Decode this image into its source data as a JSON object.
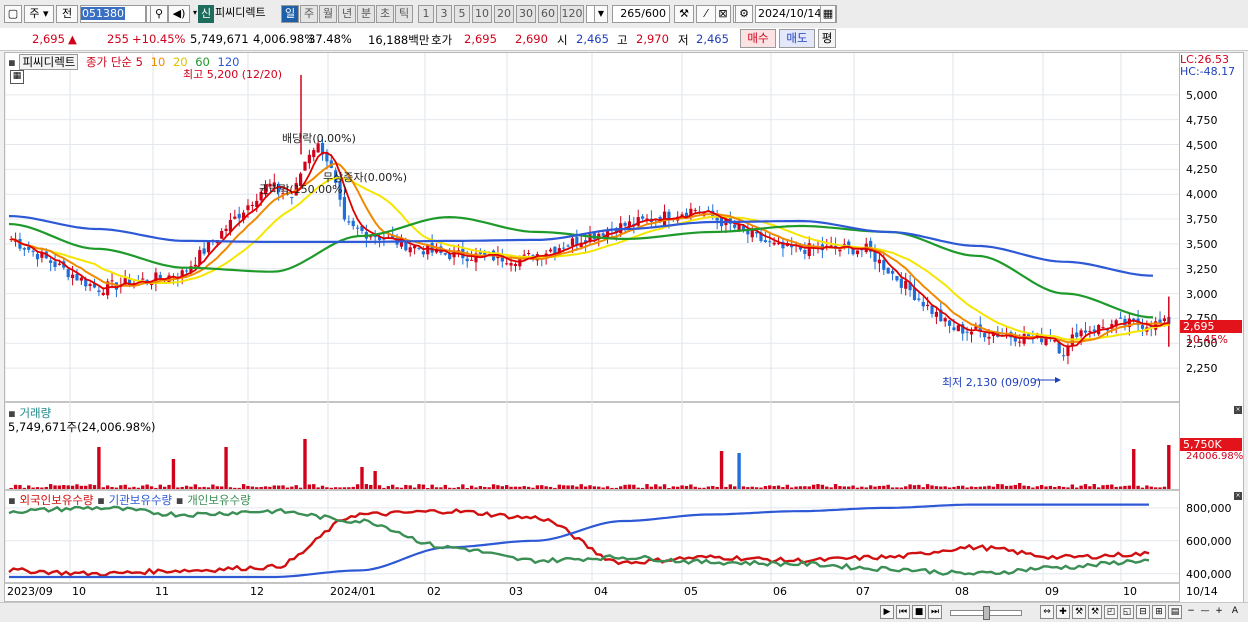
{
  "toolbar": {
    "market_type": "주",
    "market_all": "전",
    "stock_code": "051380",
    "stock_badge": "신",
    "stock_name": "피씨디렉트",
    "periods": [
      "일",
      "주",
      "월",
      "년",
      "분",
      "초",
      "틱"
    ],
    "minute_options": [
      "1",
      "3",
      "5",
      "10",
      "20",
      "30",
      "60",
      "120"
    ],
    "count_value": "265",
    "count_total": "/600",
    "date": "2024/10/14"
  },
  "quote": {
    "price": "2,695",
    "arrow": "▲",
    "change": "255",
    "change_pct": "+10.45%",
    "volume": "5,749,671",
    "volume_pct": "4,006.98%",
    "turnover": "37.48%",
    "amount": "16,188백만",
    "ask_label": "호가",
    "ask": "2,695",
    "bid": "2,690",
    "open_label": "시",
    "open": "2,465",
    "high_label": "고",
    "high": "2,970",
    "low_label": "저",
    "low": "2,465",
    "buy": "매수",
    "sell": "매도",
    "eval": "평"
  },
  "legend": {
    "name": "피씨디렉트",
    "ma_label": "종가 단순",
    "ma": [
      "5",
      "10",
      "20",
      "60",
      "120"
    ],
    "volume_title": "거래량",
    "volume_value": "5,749,671주(24,006.98%)",
    "holdings": [
      "외국인보유수량",
      "기관보유수량",
      "개인보유수량"
    ]
  },
  "annotations": {
    "high": "최고 5,200 (12/20)",
    "low": "최저 2,130 (09/09)",
    "dividend": "배당락(0.00%)",
    "rights": "권리락(150.00%)",
    "bonus": "무상증자(0.00%)"
  },
  "axis": {
    "lc": "LC:26.53",
    "hc": "HC:-48.17",
    "price_ticks": [
      "5,000",
      "4,750",
      "4,500",
      "4,250",
      "4,000",
      "3,750",
      "3,500",
      "3,250",
      "3,000",
      "2,750",
      "2,500",
      "2,250"
    ],
    "price_tag": "2,695",
    "pct_tag": "10.45%",
    "volume_tag": "5,750K",
    "volume_pct_tag": "24006.98%",
    "holding_ticks": [
      "800,000",
      "600,000",
      "400,000"
    ]
  },
  "x_axis": [
    "2023/09",
    "10",
    "11",
    "12",
    "2024/01",
    "02",
    "03",
    "04",
    "05",
    "06",
    "07",
    "08",
    "09",
    "10",
    "10/14"
  ],
  "colors": {
    "up": "#d0021b",
    "down": "#1f6fd6",
    "ma5": "#e00000",
    "ma10": "#f08a00",
    "ma20": "#f5e600",
    "ma60": "#1e9a2a",
    "ma120": "#2d58d6",
    "foreign": "#d01010",
    "institution": "#2d58d6",
    "individual": "#3b8f55"
  },
  "chart_data": {
    "type": "candlestick",
    "x": [
      "2023-09",
      "2023-10",
      "2023-11",
      "2023-12",
      "2024-01",
      "2024-02",
      "2024-03",
      "2024-04",
      "2024-05",
      "2024-06",
      "2024-07",
      "2024-08",
      "2024-09",
      "2024-10"
    ],
    "close_monthly": [
      3550,
      3050,
      3200,
      4100,
      3650,
      3400,
      3350,
      3650,
      3850,
      3450,
      3450,
      2650,
      2550,
      2695
    ],
    "ma120_monthly": [
      3780,
      3650,
      3530,
      3520,
      3520,
      3530,
      3540,
      3650,
      3720,
      3730,
      3620,
      3480,
      3320,
      3180
    ],
    "ma60_monthly": [
      3700,
      3450,
      3260,
      3220,
      3580,
      3770,
      3620,
      3550,
      3620,
      3680,
      3620,
      3380,
      3000,
      2760
    ],
    "high": {
      "value": 5200,
      "date": "12/20"
    },
    "low": {
      "value": 2130,
      "date": "09/09"
    },
    "last": {
      "price": 2695,
      "change_pct": 10.45,
      "volume": 5749671
    },
    "ylim": [
      2050,
      5300
    ],
    "holdings": {
      "series": [
        {
          "name": "외국인보유수량",
          "values": [
            420000,
            400000,
            420000,
            440000,
            760000,
            780000,
            740000,
            470000,
            500000,
            480000,
            500000,
            560000,
            500000,
            520000
          ]
        },
        {
          "name": "기관보유수량",
          "values": [
            380000,
            380000,
            380000,
            380000,
            420000,
            560000,
            600000,
            720000,
            760000,
            780000,
            800000,
            820000,
            820000,
            820000
          ]
        },
        {
          "name": "개인보유수량",
          "values": [
            780000,
            800000,
            760000,
            780000,
            720000,
            560000,
            480000,
            500000,
            470000,
            460000,
            430000,
            400000,
            440000,
            480000
          ]
        }
      ],
      "ylim": [
        380000,
        860000
      ]
    }
  }
}
